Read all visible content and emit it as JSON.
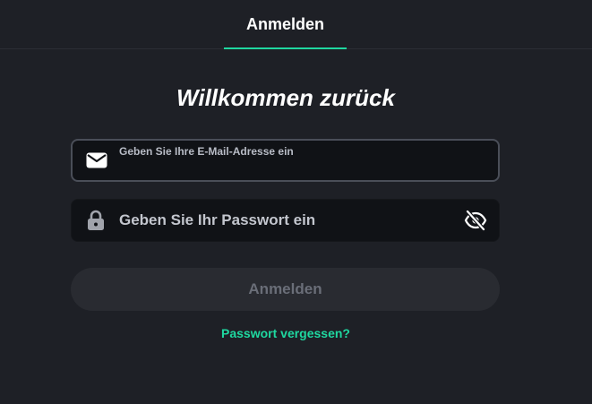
{
  "header": {
    "tab_label": "Anmelden"
  },
  "title": "Willkommen zurück",
  "email_field": {
    "placeholder": "Geben Sie Ihre E-Mail-Adresse ein",
    "value": ""
  },
  "password_field": {
    "placeholder": "Geben Sie Ihr Passwort ein",
    "value": ""
  },
  "submit_label": "Anmelden",
  "forgot_label": "Passwort vergessen?",
  "colors": {
    "accent": "#1fd8a0",
    "background": "#1e2026",
    "input": "#101216",
    "button": "#292b31"
  },
  "icons": {
    "email": "mail-icon",
    "password": "lock-icon",
    "toggle": "eye-slash-icon"
  }
}
